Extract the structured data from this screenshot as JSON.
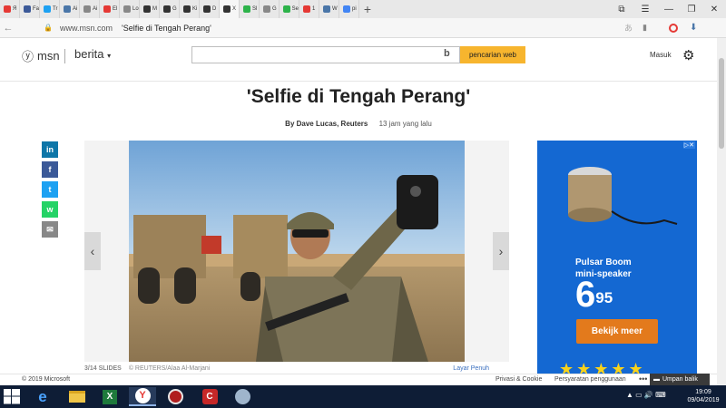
{
  "browser": {
    "tabs": [
      {
        "label": "Я",
        "color": "#e53935"
      },
      {
        "label": "Fa",
        "color": "#3b5998"
      },
      {
        "label": "Tr",
        "color": "#1da1f2"
      },
      {
        "label": "Ai",
        "color": "#4a76a8"
      },
      {
        "label": "Ai",
        "color": "#888888"
      },
      {
        "label": "El",
        "color": "#e53935"
      },
      {
        "label": "Lo",
        "color": "#888888"
      },
      {
        "label": "M",
        "color": "#333333"
      },
      {
        "label": "G",
        "color": "#333333"
      },
      {
        "label": "Ki",
        "color": "#333333"
      },
      {
        "label": "D",
        "color": "#333333"
      },
      {
        "label": "X",
        "color": "#333333",
        "active": true
      },
      {
        "label": "Sl",
        "color": "#2db34a"
      },
      {
        "label": "G",
        "color": "#888888"
      },
      {
        "label": "Se",
        "color": "#2db34a"
      },
      {
        "label": "1",
        "color": "#e53935"
      },
      {
        "label": "W",
        "color": "#4a76a8"
      },
      {
        "label": "pi",
        "color": "#4285f4"
      }
    ],
    "new_tab_label": "+",
    "url": "www.msn.com",
    "page_title": "'Selfie di Tengah Perang'"
  },
  "header": {
    "logo_text": "msn",
    "section_label": "berita",
    "search_placeholder": "",
    "search_button_label": "pencarian web",
    "signin_label": "Masuk"
  },
  "article": {
    "headline": "'Selfie di Tengah Perang'",
    "author": "By Dave Lucas, Reuters",
    "time_ago": "13 jam yang lalu",
    "share_buttons": [
      {
        "label": "in",
        "color": "#0e76a8",
        "icon": "linkedin-icon"
      },
      {
        "label": "f",
        "color": "#3b5998",
        "icon": "facebook-icon"
      },
      {
        "label": "t",
        "color": "#1da1f2",
        "icon": "twitter-icon"
      },
      {
        "label": "w",
        "color": "#25d366",
        "icon": "whatsapp-icon"
      },
      {
        "label": "✉",
        "color": "#888888",
        "icon": "mail-icon"
      }
    ],
    "slide_counter": "3/14 SLIDES",
    "slide_credit": "© REUTERS/Alaa Al-Marjani",
    "fullscreen_label": "Layar Penuh"
  },
  "ad": {
    "adchoices_label": "▷✕",
    "product_line1": "Pulsar Boom",
    "product_line2": "mini-speaker",
    "price_main": "6",
    "price_cents": "95",
    "cta_label": "Bekijk meer",
    "stars": "★★★★★",
    "background": "#1468d2",
    "cta_color": "#e37a1c"
  },
  "footer": {
    "copyright": "© 2019 Microsoft",
    "privacy": "Privasi & Cookie",
    "terms": "Persyaratan penggunaan",
    "more": "•••",
    "feedback": "Umpan balik"
  },
  "taskbar": {
    "time": "19:09",
    "date": "09/04/2019"
  }
}
